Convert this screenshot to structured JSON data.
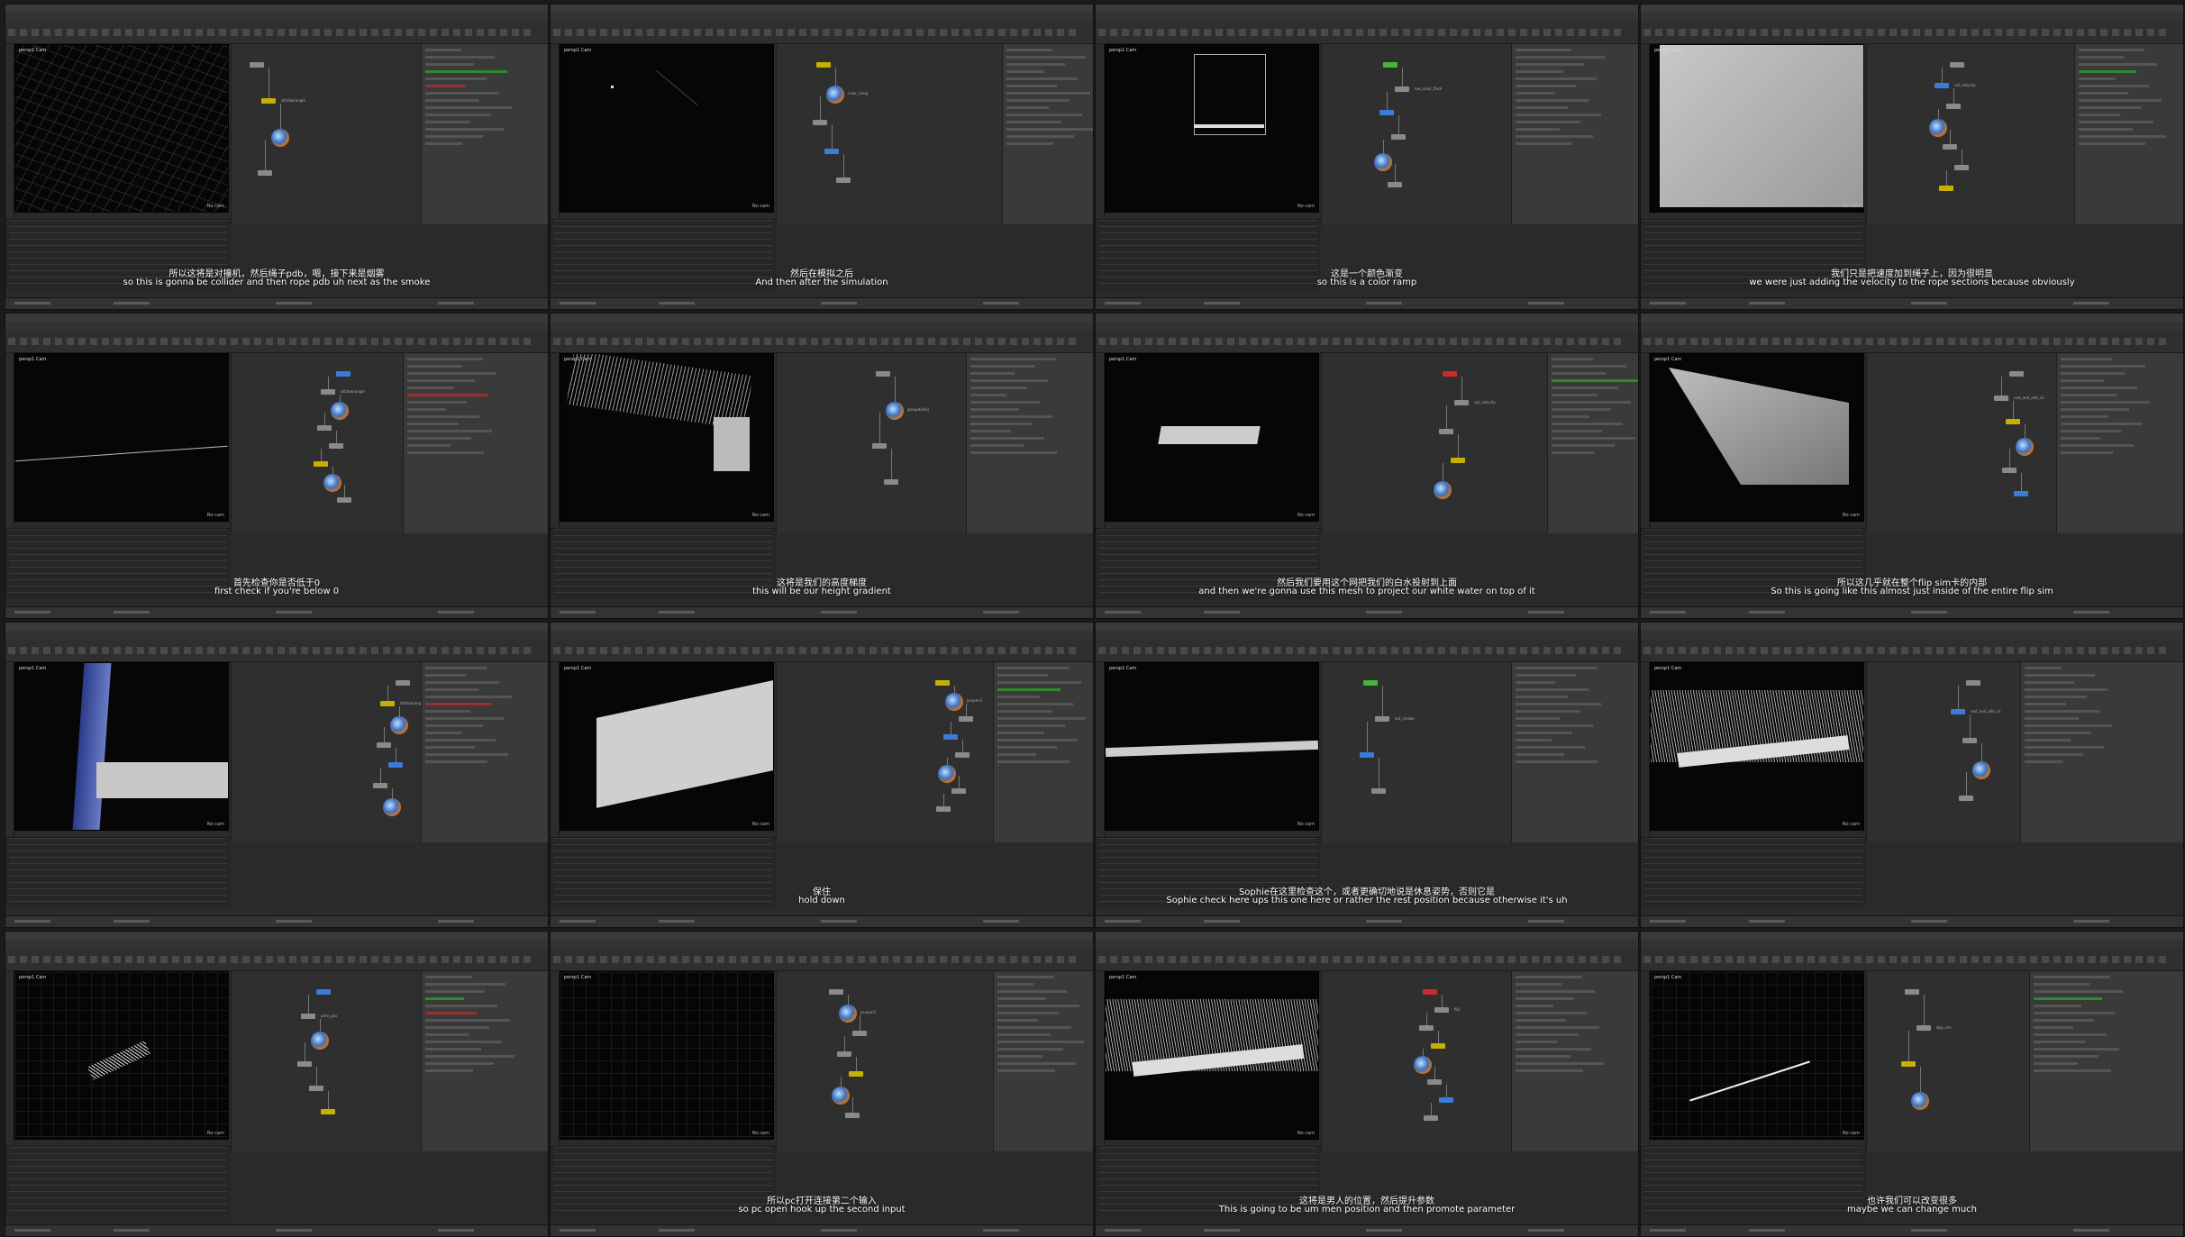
{
  "panels": [
    {
      "zh": "所以这将是对撞机，然后绳子pdb，嗯，接下来是烟雾",
      "en": "so this is gonna be collider and then rope pdb uh next as the smoke"
    },
    {
      "zh": "然后在模拟之后",
      "en": "And then after the simulation"
    },
    {
      "zh": "这是一个颜色渐变",
      "en": "so this is a color ramp"
    },
    {
      "zh": "我们只是把速度加到绳子上，因为很明显",
      "en": "we were just adding the velocity to the rope sections because obviously"
    },
    {
      "zh": "首先检查你是否低于0",
      "en": "first check if you're below 0"
    },
    {
      "zh": "这将是我们的高度梯度",
      "en": "this will be our height gradient"
    },
    {
      "zh": "然后我们要用这个网把我们的白水投射到上面",
      "en": "and then we're gonna use this mesh to project our white water on top of it"
    },
    {
      "zh": "所以这几乎就在整个flip sim卡的内部",
      "en": "So this is going like this almost just inside of the entire flip sim"
    },
    {
      "zh": "",
      "en": ""
    },
    {
      "zh": "保住",
      "en": "hold down"
    },
    {
      "zh": "Sophie在这里检查这个，或者更确切地说是休息姿势，否则它是",
      "en": "Sophie check here ups this one here or rather the rest position because otherwise it's uh"
    },
    {
      "zh": "",
      "en": ""
    },
    {
      "zh": "",
      "en": ""
    },
    {
      "zh": "所以pc打开连接第二个输入",
      "en": "so pc open hook up the second input"
    },
    {
      "zh": "这将是男人的位置，然后提升参数",
      "en": "This is going to be um men position and then promote parameter"
    },
    {
      "zh": "也许我们可以改变很多",
      "en": "maybe we can change much"
    }
  ],
  "node_labels": {
    "n1": "color_ramp",
    "n2": "low_color_flash",
    "n3": "attribwrangle",
    "n4": "set_velocity",
    "n5": "groupdelta1",
    "n6": "pcopen1",
    "n7": "fit2",
    "n8": "dop_sim",
    "n9": "out_smoke",
    "n10": "rest_and_add_v1",
    "n11": "prim_pos"
  },
  "viewport_label": "persp1  Cam",
  "camera_label": "No cam"
}
